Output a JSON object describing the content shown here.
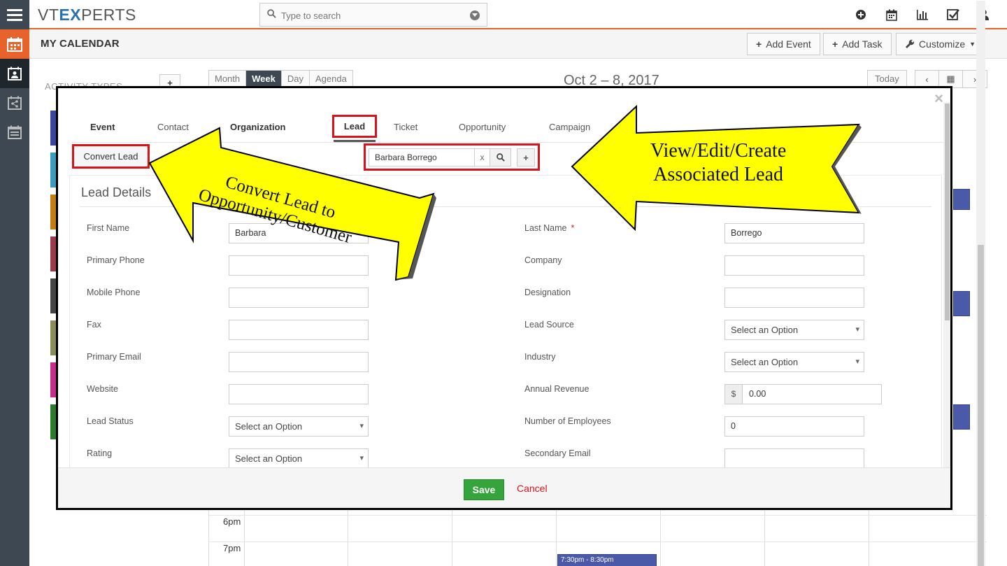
{
  "topbar": {
    "logo_a": "VT",
    "logo_b": "EX",
    "logo_c": "PERTS",
    "search_placeholder": "Type to search"
  },
  "page": {
    "title": "MY CALENDAR",
    "add_event": "Add Event",
    "add_task": "Add Task",
    "customize": "Customize"
  },
  "calendar": {
    "activity_types": "ACTIVITY TYPES",
    "views": [
      "Month",
      "Week",
      "Day",
      "Agenda"
    ],
    "active_view": "Week",
    "date_range": "Oct 2 – 8, 2017",
    "today": "Today",
    "times": [
      "6pm",
      "7pm"
    ],
    "event_time": "7:30pm - 8:30pm",
    "swatch_colors": [
      "#3a45a0",
      "#3c9cc0",
      "#c47d12",
      "#9a3a4a",
      "#444444",
      "#8a8c5a",
      "#c72d8a",
      "#2c7a2c"
    ]
  },
  "modal": {
    "tabs": [
      "Event",
      "Contact",
      "Organization",
      "Lead",
      "Ticket",
      "Opportunity",
      "Campaign"
    ],
    "active_tab": "Lead",
    "convert_lead": "Convert Lead",
    "lead_value": "Barbara Borrego",
    "clear": "x",
    "section_title": "Lead Details",
    "left_fields": [
      {
        "label": "First Name",
        "value": "Barbara",
        "type": "text"
      },
      {
        "label": "Primary Phone",
        "value": "",
        "type": "text"
      },
      {
        "label": "Mobile Phone",
        "value": "",
        "type": "text"
      },
      {
        "label": "Fax",
        "value": "",
        "type": "text"
      },
      {
        "label": "Primary Email",
        "value": "",
        "type": "text"
      },
      {
        "label": "Website",
        "value": "",
        "type": "text"
      },
      {
        "label": "Lead Status",
        "value": "Select an Option",
        "type": "select"
      },
      {
        "label": "Rating",
        "value": "Select an Option",
        "type": "select"
      }
    ],
    "right_fields": [
      {
        "label": "Last Name",
        "value": "Borrego",
        "type": "text",
        "required": true
      },
      {
        "label": "Company",
        "value": "",
        "type": "text"
      },
      {
        "label": "Designation",
        "value": "",
        "type": "text"
      },
      {
        "label": "Lead Source",
        "value": "Select an Option",
        "type": "select"
      },
      {
        "label": "Industry",
        "value": "Select an Option",
        "type": "select"
      },
      {
        "label": "Annual Revenue",
        "value": "0.00",
        "type": "currency",
        "symbol": "$"
      },
      {
        "label": "Number of Employees",
        "value": "0",
        "type": "text"
      },
      {
        "label": "Secondary Email",
        "value": "",
        "type": "text"
      }
    ],
    "required_mark": "*",
    "save": "Save",
    "cancel": "Cancel"
  },
  "annotations": {
    "left_line1": "Convert Lead to",
    "left_line2": "Opportunity/Customer",
    "right_line1": "View/Edit/Create",
    "right_line2": "Associated Lead",
    "arrow_fill": "#ffff00"
  },
  "colors": {
    "accent": "#e8632b",
    "nav": "#3d4852",
    "highlight": "#d9131b",
    "save": "#35a53b"
  }
}
